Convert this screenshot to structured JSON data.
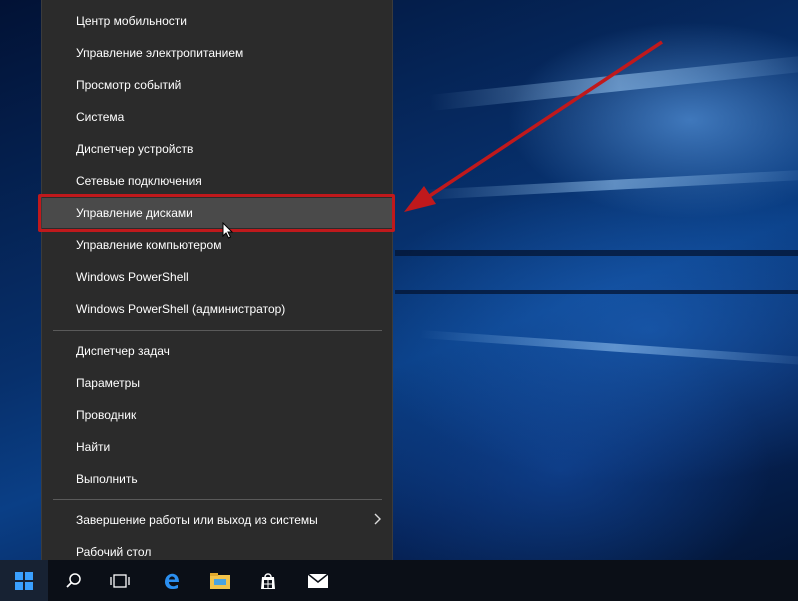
{
  "menu": {
    "items": [
      {
        "label": "Центр мобильности"
      },
      {
        "label": "Управление электропитанием"
      },
      {
        "label": "Просмотр событий"
      },
      {
        "label": "Система"
      },
      {
        "label": "Диспетчер устройств"
      },
      {
        "label": "Сетевые подключения"
      },
      {
        "label": "Управление дисками"
      },
      {
        "label": "Управление компьютером"
      },
      {
        "label": "Windows PowerShell"
      },
      {
        "label": "Windows PowerShell (администратор)"
      },
      {
        "label": "Диспетчер задач"
      },
      {
        "label": "Параметры"
      },
      {
        "label": "Проводник"
      },
      {
        "label": "Найти"
      },
      {
        "label": "Выполнить"
      },
      {
        "label": "Завершение работы или выход из системы"
      },
      {
        "label": "Рабочий стол"
      }
    ],
    "highlighted_item": "Управление дисками"
  },
  "annotation": {
    "color": "#c0191c"
  },
  "taskbar": {
    "icons": [
      "windows-start-icon",
      "search-icon",
      "task-view-icon",
      "edge-icon",
      "file-explorer-icon",
      "store-icon",
      "mail-icon"
    ]
  }
}
